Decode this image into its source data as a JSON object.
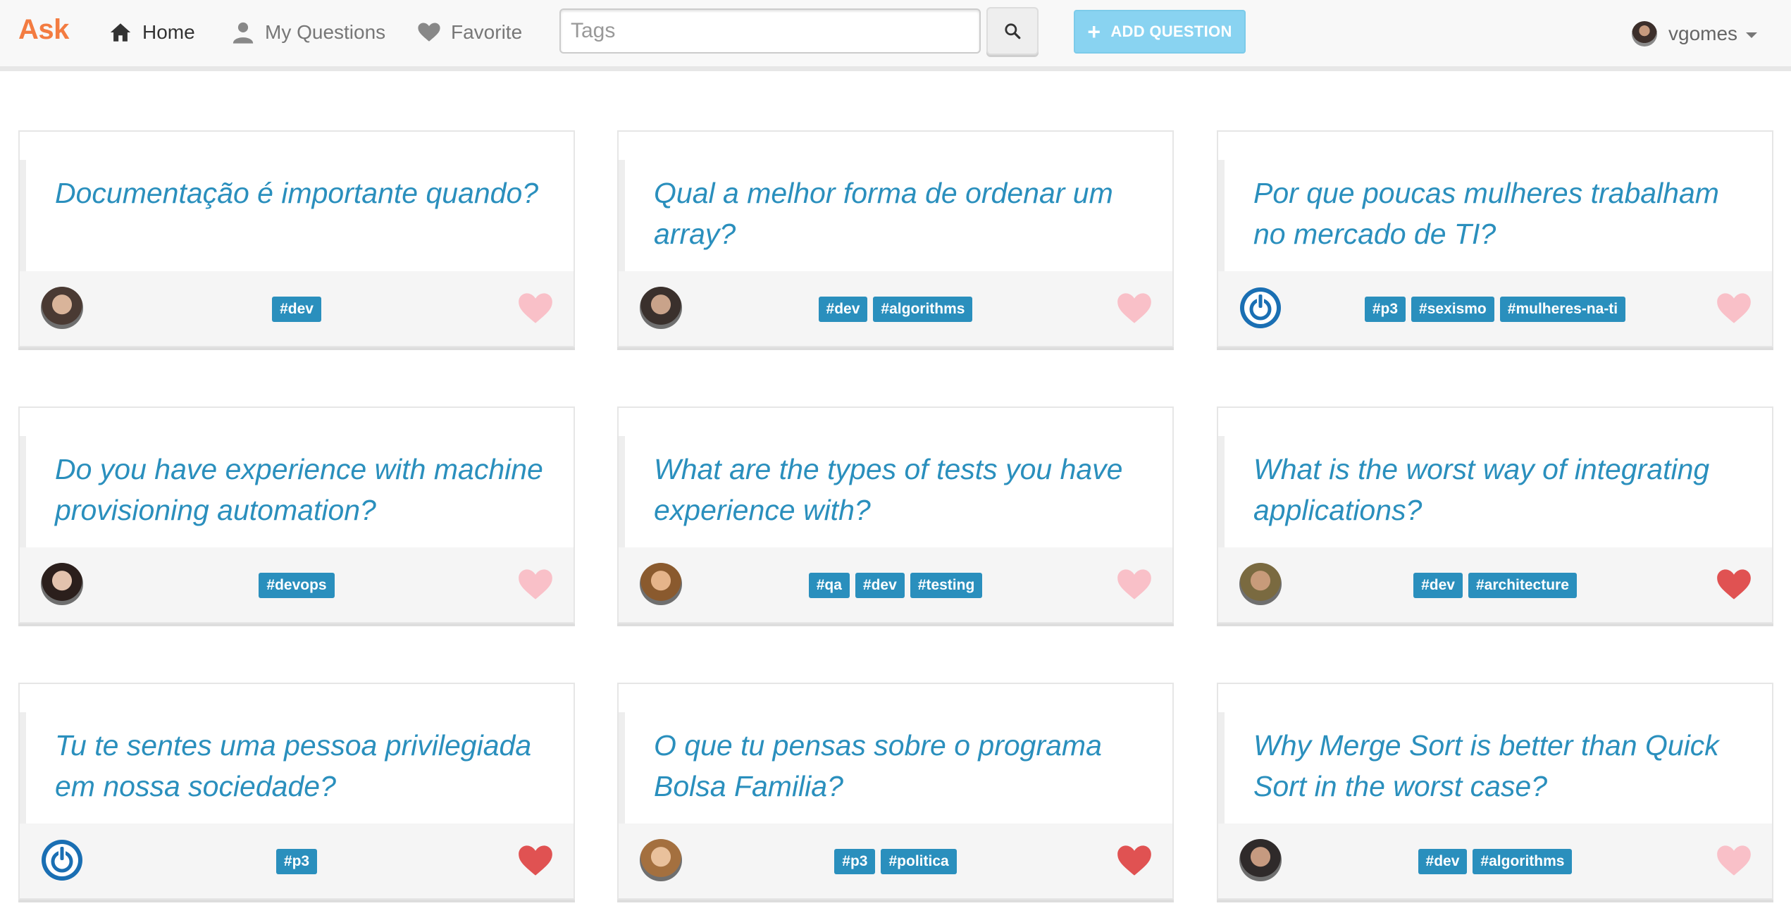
{
  "app": {
    "brand": "Ask"
  },
  "nav": {
    "home": "Home",
    "my_questions": "My Questions",
    "favorite": "Favorite"
  },
  "search": {
    "placeholder": "Tags",
    "value": ""
  },
  "add_question_label": "ADD QUESTION",
  "user": {
    "name": "vgomes"
  },
  "colors": {
    "brand": "#f37c41",
    "accent": "#2a8fbd",
    "heart_favorited": "#e05252",
    "heart_unfavorited": "#f9c0c8",
    "add_button": "#89d3f1"
  },
  "questions": [
    {
      "title": "Documentação é importante quando?",
      "tags": [
        "#dev"
      ],
      "favorited": false,
      "avatar": "user-photo"
    },
    {
      "title": "Qual a melhor forma de ordenar um array?",
      "tags": [
        "#dev",
        "#algorithms"
      ],
      "favorited": false,
      "avatar": "user-photo"
    },
    {
      "title": "Por que poucas mulheres trabalham no mercado de TI?",
      "tags": [
        "#p3",
        "#sexismo",
        "#mulheres-na-ti"
      ],
      "favorited": false,
      "avatar": "power-logo"
    },
    {
      "title": "Do you have experience with machine provisioning automation?",
      "tags": [
        "#devops"
      ],
      "favorited": false,
      "avatar": "user-photo"
    },
    {
      "title": "What are the types of tests you have experience with?",
      "tags": [
        "#qa",
        "#dev",
        "#testing"
      ],
      "favorited": false,
      "avatar": "user-photo"
    },
    {
      "title": "What is the worst way of integrating applications?",
      "tags": [
        "#dev",
        "#architecture"
      ],
      "favorited": true,
      "avatar": "user-photo"
    },
    {
      "title": "Tu te sentes uma pessoa privilegiada em nossa sociedade?",
      "tags": [
        "#p3"
      ],
      "favorited": true,
      "avatar": "power-logo"
    },
    {
      "title": "O que tu pensas sobre o programa Bolsa Familia?",
      "tags": [
        "#p3",
        "#politica"
      ],
      "favorited": true,
      "avatar": "user-photo"
    },
    {
      "title": "Why Merge Sort is better than Quick Sort in the worst case?",
      "tags": [
        "#dev",
        "#algorithms"
      ],
      "favorited": false,
      "avatar": "user-photo"
    }
  ]
}
